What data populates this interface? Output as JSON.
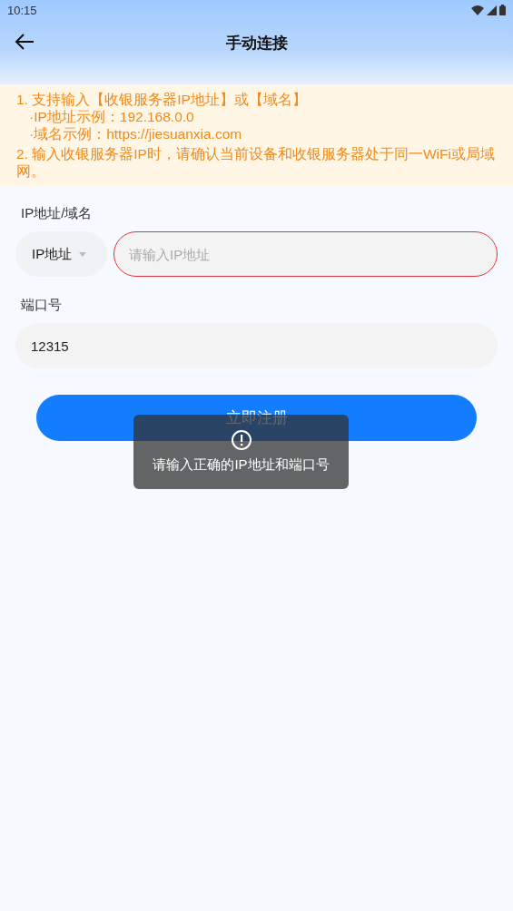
{
  "status_bar": {
    "time": "10:15"
  },
  "header": {
    "title": "手动连接"
  },
  "notice": {
    "lines": [
      {
        "kind": "item",
        "text": "1. 支持输入【收银服务器IP地址】或【域名】"
      },
      {
        "kind": "sub",
        "text": "·IP地址示例：192.168.0.0"
      },
      {
        "kind": "sub",
        "text": "·域名示例：https://jiesuanxia.com"
      },
      {
        "kind": "item",
        "text": "2. 输入收银服务器IP时，请确认当前设备和收银服务器处于同一WiFi或局域网。"
      }
    ]
  },
  "address": {
    "label": "IP地址/域名",
    "type_select": "IP地址",
    "placeholder": "请输入IP地址",
    "error": true
  },
  "port": {
    "label": "端口号",
    "value": "12315"
  },
  "submit_button": "立即注册",
  "toast": {
    "message": "请输入正确的IP地址和端口号"
  }
}
